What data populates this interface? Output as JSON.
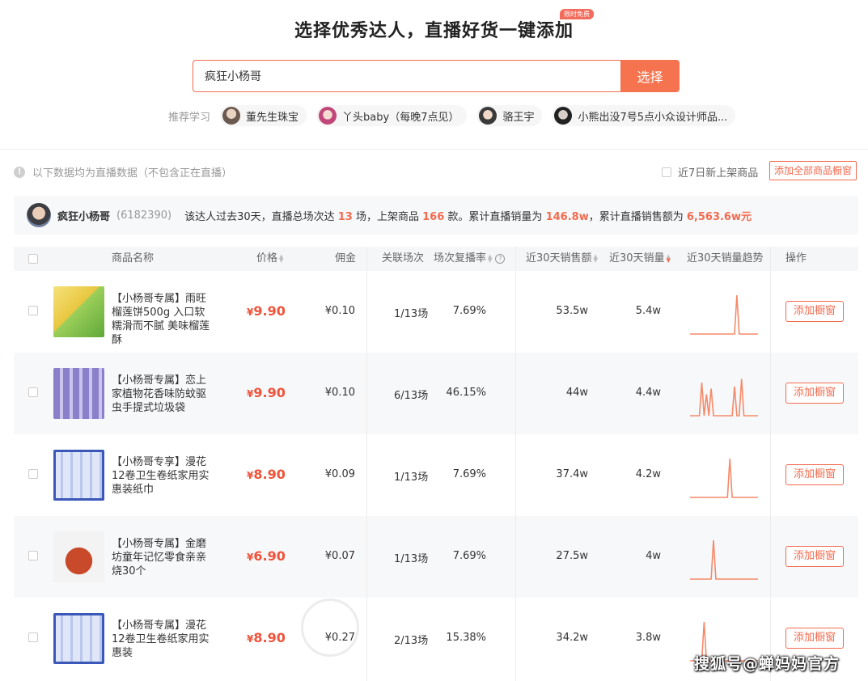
{
  "header": {
    "title": "选择优秀达人，直播好货一键添加",
    "badge": "限时免费"
  },
  "search": {
    "value": "疯狂小杨哥",
    "button": "选择"
  },
  "recommend": {
    "label": "推荐学习",
    "items": [
      {
        "name": "董先生珠宝"
      },
      {
        "name": "丫头baby（每晚7点见）"
      },
      {
        "name": "骆王宇"
      },
      {
        "name": "小熊出没7号5点小众设计师品..."
      }
    ]
  },
  "notice": {
    "text": "以下数据均为直播数据（不包含正在直播）",
    "new7_label": "近7日新上架商品",
    "add_all": "添加全部商品橱窗"
  },
  "stats": {
    "name": "疯狂小杨哥",
    "id": "(6182390)",
    "t1": "该达人过去30天，直播总场次达",
    "sessions": "13",
    "t2": "场，上架商品",
    "products": "166",
    "t3": "款。累计直播销量为",
    "sales": "146.8w",
    "t4": "，累计直播销售额为",
    "revenue": "6,563.6w元"
  },
  "columns": {
    "name": "商品名称",
    "price": "价格",
    "commission": "佣金",
    "sessions": "关联场次",
    "repeat": "场次复播率",
    "amount30": "近30天销售额",
    "volume30": "近30天销量",
    "trend30": "近30天销量趋势",
    "action": "操作"
  },
  "rows": [
    {
      "name": "【小杨哥专属】雨旺榴莲饼500g 入口软糯滑而不腻 美味榴莲酥",
      "price": "9.90",
      "commission": "¥0.10",
      "sessions": "1/13场",
      "rate": "7.69%",
      "amount": "53.5w",
      "volume": "5.4w",
      "action": "添加橱窗",
      "trend": [
        0,
        0,
        0,
        0,
        0,
        0,
        0,
        0,
        0,
        0,
        0,
        0,
        0,
        0,
        0,
        0,
        0,
        0,
        0,
        0,
        1,
        0,
        0,
        0,
        0,
        0,
        0,
        0,
        0,
        0
      ]
    },
    {
      "name": "【小杨哥专属】恋上家植物花香味防蚊驱虫手提式垃圾袋",
      "price": "9.90",
      "commission": "¥0.10",
      "sessions": "6/13场",
      "rate": "46.15%",
      "amount": "44w",
      "volume": "4.4w",
      "action": "添加橱窗",
      "trend": [
        0,
        0,
        0,
        0,
        0,
        0.85,
        0,
        0.55,
        0,
        0.7,
        0,
        0,
        0,
        0,
        0,
        0,
        0,
        0,
        0,
        0.75,
        0,
        0,
        0.95,
        0,
        0,
        0,
        0,
        0,
        0,
        0
      ]
    },
    {
      "name": "【小杨哥专享】漫花12卷卫生卷纸家用实惠装纸巾",
      "price": "8.90",
      "commission": "¥0.09",
      "sessions": "1/13场",
      "rate": "7.69%",
      "amount": "37.4w",
      "volume": "4.2w",
      "action": "添加橱窗",
      "trend": [
        0,
        0,
        0,
        0,
        0,
        0,
        0,
        0,
        0,
        0,
        0,
        0,
        0,
        0,
        0,
        0,
        0,
        1,
        0,
        0,
        0,
        0,
        0,
        0,
        0,
        0,
        0,
        0,
        0,
        0
      ]
    },
    {
      "name": "【小杨哥专属】金磨坊童年记忆零食亲亲烧30个",
      "price": "6.90",
      "commission": "¥0.07",
      "sessions": "1/13场",
      "rate": "7.69%",
      "amount": "27.5w",
      "volume": "4w",
      "action": "添加橱窗",
      "trend": [
        0,
        0,
        0,
        0,
        0,
        0,
        0,
        0,
        0,
        0,
        1,
        0,
        0,
        0,
        0,
        0,
        0,
        0,
        0,
        0,
        0,
        0,
        0,
        0,
        0,
        0,
        0,
        0,
        0,
        0
      ]
    },
    {
      "name": "【小杨哥专属】漫花12卷卫生卷纸家用实惠装",
      "price": "8.90",
      "commission": "¥0.27",
      "sessions": "2/13场",
      "rate": "15.38%",
      "amount": "34.2w",
      "volume": "3.8w",
      "action": "添加橱窗",
      "trend": [
        0,
        0,
        0,
        0,
        0,
        0,
        1,
        0,
        0,
        0,
        0,
        0,
        0,
        0,
        0,
        0,
        0,
        0,
        0,
        0,
        0,
        0,
        0,
        0,
        0,
        0,
        0,
        0,
        0,
        0
      ]
    }
  ],
  "colors": {
    "accent": "#f26b4f",
    "price": "#f0533a",
    "trend": "#f58a6a"
  },
  "watermark": "搜狐号@蝉妈妈官方"
}
